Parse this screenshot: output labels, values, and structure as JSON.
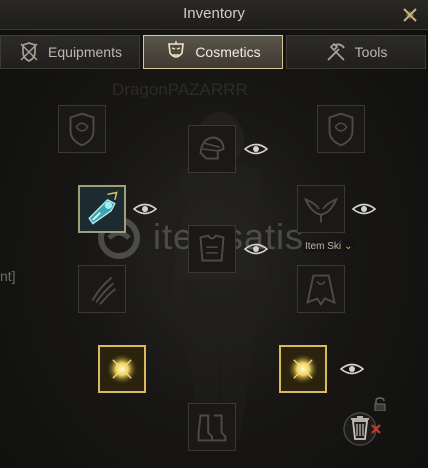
{
  "window": {
    "title": "Inventory"
  },
  "tabs": [
    {
      "label": "Equipments",
      "icon": "shield-swords-icon",
      "active": false
    },
    {
      "label": "Cosmetics",
      "icon": "cosmetics-mask-icon",
      "active": true
    },
    {
      "label": "Tools",
      "icon": "pickaxe-shovel-icon",
      "active": false
    }
  ],
  "background": {
    "character_name": "DragonPAZARRR",
    "watermark": "itemsatis",
    "side_text": "nt]"
  },
  "slots": {
    "left_shield_top": {
      "icon": "shield-outline-icon",
      "filled": false
    },
    "right_shield_top": {
      "icon": "shield-outline-icon",
      "filled": false
    },
    "head": {
      "icon": "helmet-outline-icon",
      "filled": false,
      "visible": true
    },
    "left_weapon": {
      "icon": "blue-weapon-skin-icon",
      "filled": true,
      "visible": true
    },
    "back": {
      "icon": "wings-outline-icon",
      "filled": false,
      "visible": true
    },
    "chest": {
      "icon": "chest-armor-outline-icon",
      "filled": false,
      "visible": true
    },
    "hands": {
      "icon": "claw-outline-icon",
      "filled": false
    },
    "cloak": {
      "icon": "cloak-outline-icon",
      "filled": false
    },
    "left_accessory": {
      "icon": "golden-orb-icon",
      "filled": true
    },
    "right_accessory": {
      "icon": "golden-orb-icon",
      "filled": true,
      "visible": true
    },
    "feet": {
      "icon": "boots-outline-icon",
      "filled": false
    }
  },
  "item_skin_label": "Item Ski",
  "colors": {
    "accent_gold": "#d9b95a",
    "active_tab": "#4a463d"
  }
}
